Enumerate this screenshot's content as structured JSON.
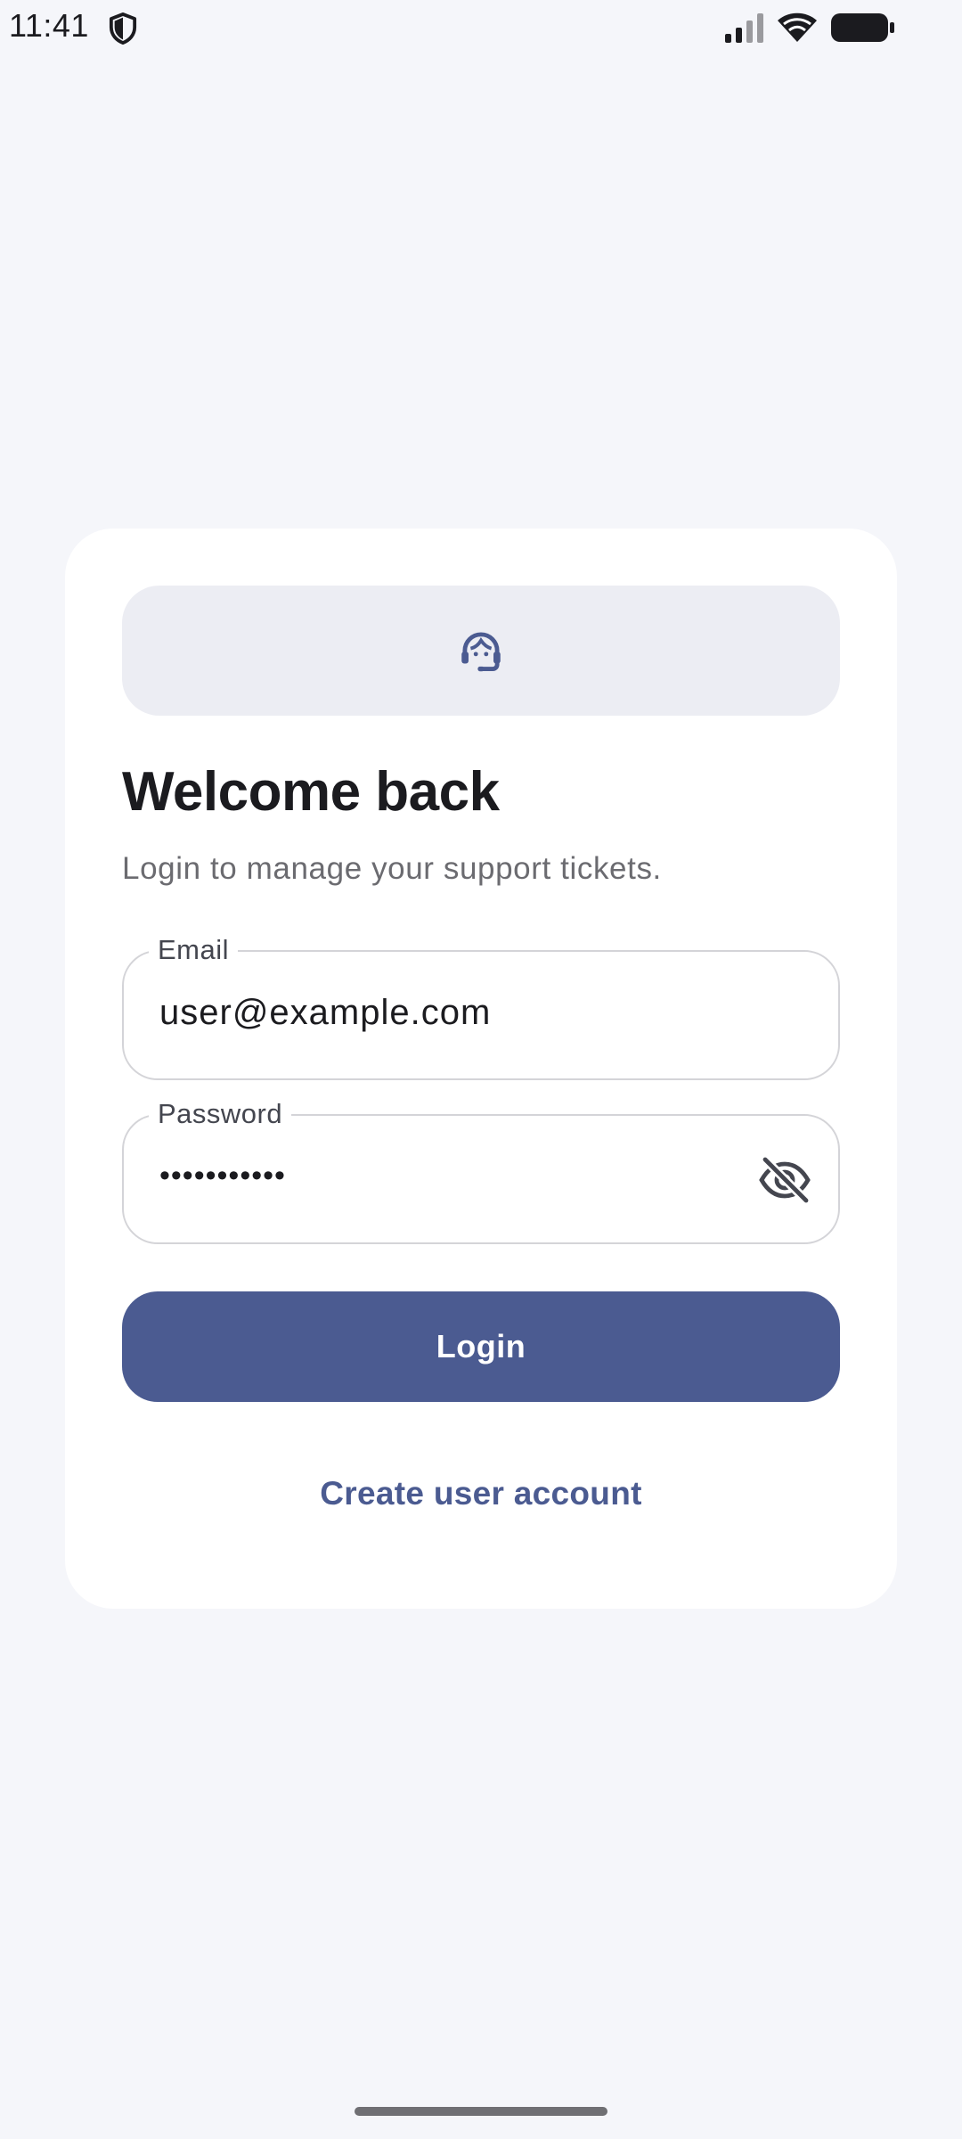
{
  "status_bar": {
    "time": "11:41",
    "icons": [
      "shield-icon",
      "signal-icon",
      "wifi-icon",
      "battery-icon"
    ]
  },
  "header": {
    "icon": "support-agent-icon",
    "title": "Welcome back",
    "subtitle": "Login to manage your support tickets."
  },
  "form": {
    "email": {
      "label": "Email",
      "value": "user@example.com"
    },
    "password": {
      "label": "Password",
      "masked_value": "•••••••••••",
      "toggle_icon": "visibility-off-icon"
    },
    "login_label": "Login",
    "create_account_label": "Create user account"
  },
  "colors": {
    "background": "#f5f6fa",
    "card": "#ffffff",
    "primary": "#4b5b91",
    "banner": "#ecedf3",
    "border": "#d4d4d8"
  }
}
